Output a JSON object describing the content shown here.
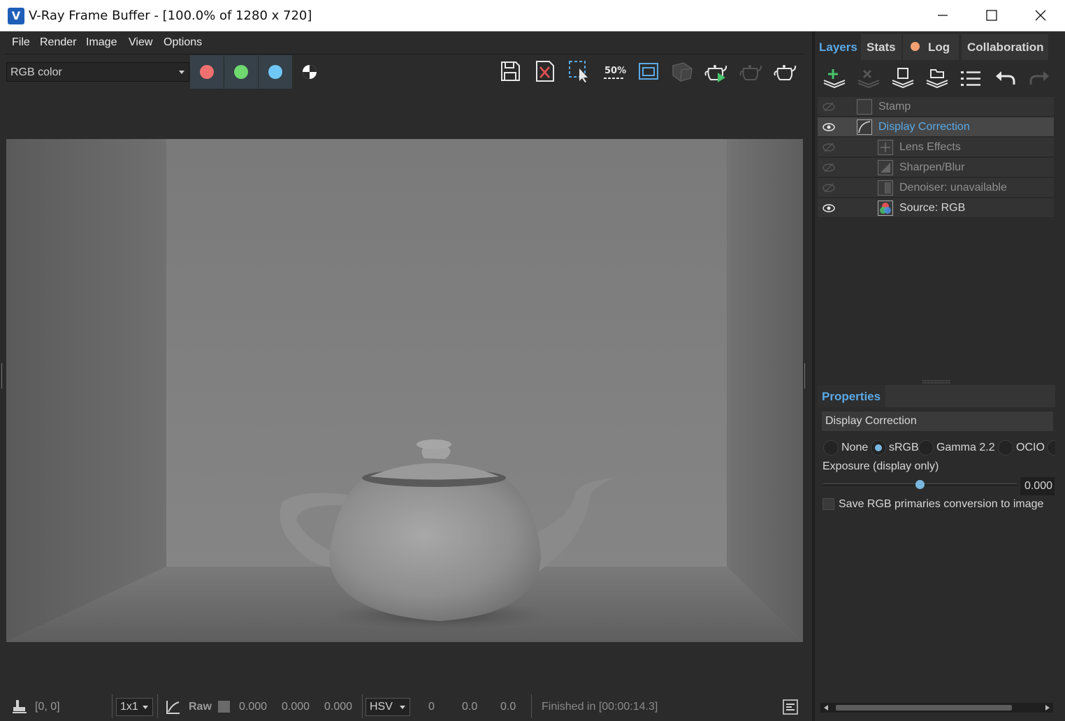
{
  "window": {
    "title": "V-Ray Frame Buffer - [100.0% of 1280 x 720]",
    "icon": "vray-logo-icon",
    "controls": [
      "minimize-icon",
      "maximize-icon",
      "close-icon"
    ]
  },
  "menu": [
    "File",
    "Render",
    "Image",
    "View",
    "Options"
  ],
  "toolbar": {
    "channel_select": "RGB color",
    "channel_buttons": [
      {
        "name": "red-channel",
        "color": "#f07070"
      },
      {
        "name": "green-channel",
        "color": "#6fd86f"
      },
      {
        "name": "blue-channel",
        "color": "#6fc7f5"
      }
    ],
    "zoom_label": "50%",
    "icons": [
      "save-icon",
      "clear-icon",
      "region-render-icon",
      "zoom-50-icon",
      "fit-window-icon",
      "interactive-icon",
      "render-icon",
      "render-disabled-icon",
      "teapot-icon"
    ]
  },
  "right_panel": {
    "tabs": [
      {
        "label": "Layers",
        "active": true
      },
      {
        "label": "Stats",
        "active": false
      },
      {
        "label": "Log",
        "active": false,
        "indicator_color": "#f0a070"
      },
      {
        "label": "Collaboration",
        "active": false
      }
    ],
    "layers": [
      {
        "name": "Stamp",
        "enabled": false,
        "selected": false,
        "indent": 0,
        "icon": "stamp-icon"
      },
      {
        "name": "Display Correction",
        "enabled": true,
        "selected": true,
        "indent": 0,
        "icon": "curve-icon"
      },
      {
        "name": "Lens Effects",
        "enabled": false,
        "selected": false,
        "indent": 1,
        "icon": "lens-effects-icon"
      },
      {
        "name": "Sharpen/Blur",
        "enabled": false,
        "selected": false,
        "indent": 1,
        "icon": "sharpen-icon"
      },
      {
        "name": "Denoiser: unavailable",
        "enabled": false,
        "selected": false,
        "indent": 1,
        "icon": "denoiser-icon"
      },
      {
        "name": "Source: RGB",
        "enabled": true,
        "selected": false,
        "indent": 1,
        "icon": "rgb-source-icon"
      }
    ],
    "properties": {
      "tab": "Properties",
      "title": "Display Correction",
      "transfer_options": [
        {
          "label": "None",
          "checked": false
        },
        {
          "label": "sRGB",
          "checked": true
        },
        {
          "label": "Gamma 2.2",
          "checked": false
        },
        {
          "label": "OCIO",
          "checked": false
        }
      ],
      "exposure_label": "Exposure (display only)",
      "exposure_value": "0.000",
      "exposure_fraction": 0.5,
      "checkbox_label": "Save RGB primaries conversion to image",
      "checkbox_checked": false
    }
  },
  "status": {
    "coords": "[0, 0]",
    "sample_size": "1x1",
    "raw_label": "Raw",
    "rgb_values": [
      "0.000",
      "0.000",
      "0.000"
    ],
    "color_mode": "HSV",
    "hsv_values": [
      "0",
      "0.0",
      "0.0"
    ],
    "render_status": "Finished in [00:00:14.3]"
  }
}
